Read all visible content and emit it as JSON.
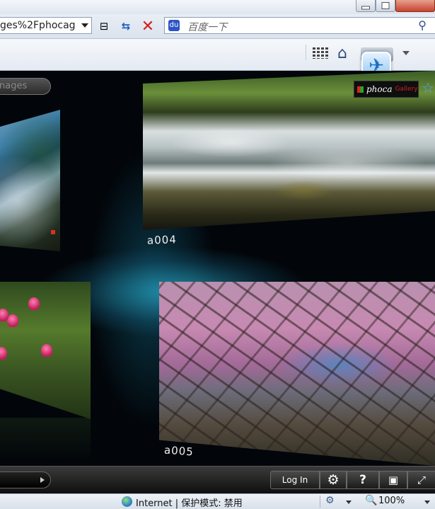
{
  "browser": {
    "address_text": "ges%2Fphocag",
    "search_placeholder": "百度一下",
    "search_logo": "du",
    "icons": {
      "compat": "compatibility-view-icon",
      "refresh": "refresh-icon",
      "stop": "stop-icon",
      "search": "search-icon",
      "feeds": "feed-icon",
      "home": "home-icon",
      "quick_tabs": "quick-tabs-icon"
    },
    "glyphs": {
      "compat": "⊟",
      "refresh": "⇆",
      "stop": "✕",
      "search": "⚲",
      "home": "⌂",
      "bird": "✈"
    }
  },
  "gallery": {
    "search_placeholder": "nages",
    "photos": [
      {
        "caption": "",
        "subject": "lake-waterfall"
      },
      {
        "caption": "a004",
        "subject": "waterfall"
      },
      {
        "caption": "",
        "subject": "pink-flowers"
      },
      {
        "caption": "a005",
        "subject": "cherry-tree"
      }
    ],
    "logo": {
      "name": "phoca",
      "suffix": "Gallery"
    },
    "star_glyph": "☆"
  },
  "player": {
    "login_label": "Log In",
    "settings_glyph": "⚙",
    "help_glyph": "?",
    "slideshow_glyph": "▣",
    "fullscreen_glyph": "⤢"
  },
  "status": {
    "zone_text": "Internet | 保护模式: 禁用",
    "zoom": "100%",
    "zoom_glyph": "🔍"
  }
}
